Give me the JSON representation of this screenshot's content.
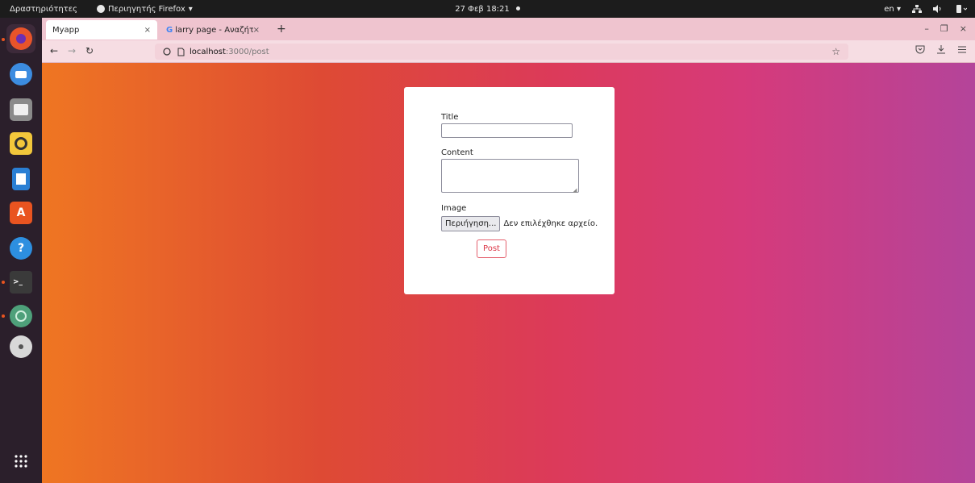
{
  "topbar": {
    "activities": "Δραστηριότητες",
    "app_menu": "Περιηγητής Firefox",
    "app_menu_caret": "▾",
    "clock": "27 Φεβ 18:21",
    "lang": "en",
    "lang_caret": "▾",
    "tray_icons": [
      "network-icon",
      "volume-icon",
      "battery-icon"
    ]
  },
  "dock": {
    "apps": [
      {
        "name": "firefox",
        "color": "#e8542a",
        "running": true
      },
      {
        "name": "thunderbird",
        "color": "#3c8ce0",
        "running": false
      },
      {
        "name": "files",
        "color": "#8a8a8a",
        "running": false
      },
      {
        "name": "rhythmbox",
        "color": "#f2c73b",
        "running": false
      },
      {
        "name": "libreoffice-writer",
        "color": "#2a7fd4",
        "running": false
      },
      {
        "name": "software",
        "color": "#e95420",
        "running": false
      },
      {
        "name": "help",
        "color": "#2d8fe0",
        "running": false
      },
      {
        "name": "terminal",
        "color": "#3a3a3a",
        "running": true
      },
      {
        "name": "atom",
        "color": "#4ea07a",
        "running": true
      },
      {
        "name": "disc",
        "color": "#d8d8d8",
        "running": false
      }
    ]
  },
  "browser": {
    "tabs": [
      {
        "title": "Myapp",
        "close": "×"
      },
      {
        "title": "larry page - Αναζήτηση G",
        "close": "×"
      }
    ],
    "new_tab": "+",
    "window_controls": [
      "–",
      "❐",
      "×"
    ],
    "url_host": "localhost",
    "url_path": ":3000/post"
  },
  "form": {
    "title_label": "Title",
    "title_value": "",
    "content_label": "Content",
    "content_value": "",
    "image_label": "Image",
    "browse_button": "Περιήγηση...",
    "no_file": "Δεν επιλέχθηκε αρχείο.",
    "submit": "Post"
  },
  "colors": {
    "accent": "#dc3545",
    "ubuntu_orange": "#e95420"
  }
}
